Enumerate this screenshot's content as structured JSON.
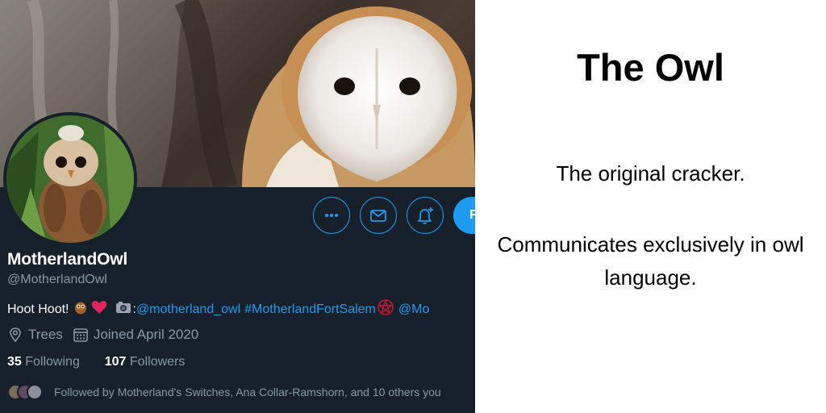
{
  "profile": {
    "display_name": "MotherlandOwl",
    "handle": "@MotherlandOwl",
    "bio": {
      "text": "Hoot Hoot!",
      "camera_prefix": ":",
      "link_handle": "@motherland_owl",
      "hashtag": "#MotherlandFortSalem",
      "trailing_mention": "@Mo"
    },
    "location": "Trees",
    "joined": "Joined April 2020",
    "following_count": "35",
    "following_label": "Following",
    "followers_count": "107",
    "followers_label": "Followers",
    "followed_by": "Followed by Motherland's Switches, Ana Collar-Ramshorn, and 10 others you",
    "follow_button_label": "F",
    "icons": [
      "more-icon",
      "message-icon",
      "notification-bell-icon",
      "location-pin-icon",
      "calendar-icon",
      "owl-emoji",
      "heart-emoji",
      "camera-emoji",
      "pentacle-emoji"
    ]
  },
  "caption": {
    "title": "The Owl",
    "line1": "The original cracker.",
    "line2": "Communicates exclusively in owl language."
  },
  "colors": {
    "background": "#15202b",
    "accent": "#1d9bf0",
    "muted": "#8899a6"
  }
}
